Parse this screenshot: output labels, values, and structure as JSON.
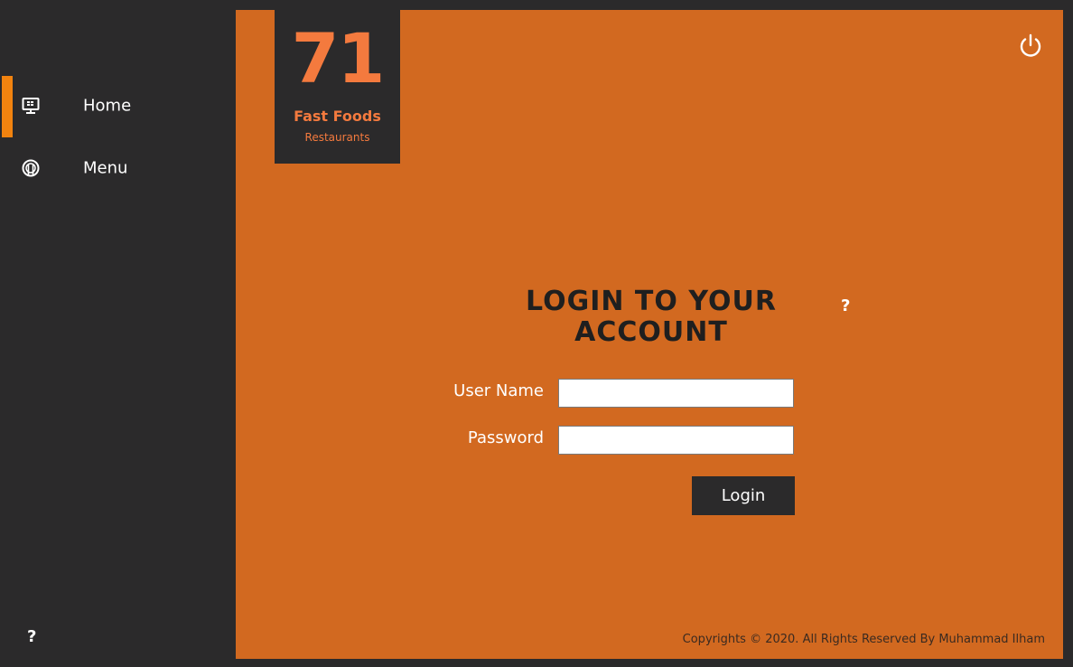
{
  "sidebar": {
    "items": [
      {
        "label": "Home",
        "icon": "monitor-icon",
        "active": true
      },
      {
        "label": "Menu",
        "icon": "restaurant-icon",
        "active": false
      }
    ],
    "help_label": "?"
  },
  "logo": {
    "number": "71",
    "title": "Fast Foods",
    "subtitle": "Restaurants"
  },
  "header": {
    "power_icon": "power-icon"
  },
  "login": {
    "title_line1": "LOGIN TO YOUR",
    "title_line2": "ACCOUNT",
    "help_label": "?",
    "username_label": "User Name",
    "password_label": "Password",
    "username_value": "",
    "password_value": "",
    "button_label": "Login"
  },
  "footer": {
    "copyright": "Copyrights © 2020. All Rights Reserved By Muhammad Ilham"
  },
  "colors": {
    "accent": "#f2830f",
    "panel": "#d26920",
    "dark": "#2b2a2b",
    "logo_text": "#f47a3e"
  }
}
